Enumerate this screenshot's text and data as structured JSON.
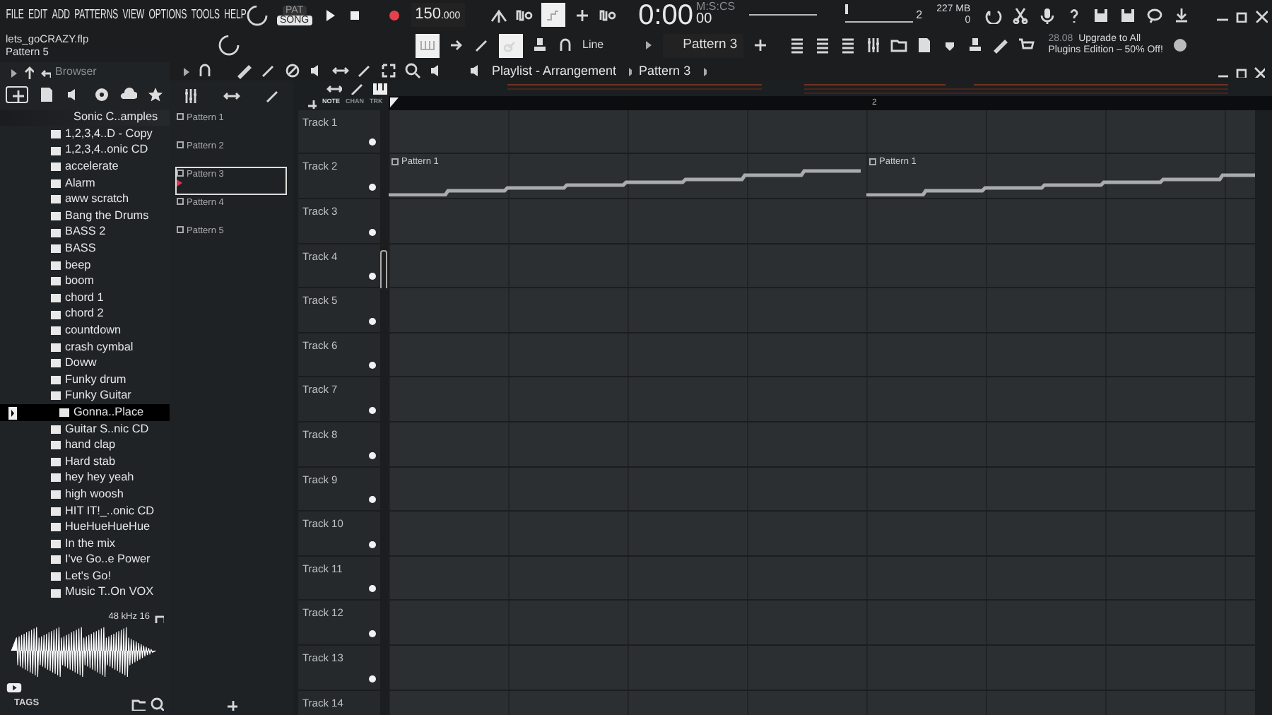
{
  "menu": [
    "FILE",
    "EDIT",
    "ADD",
    "PATTERNS",
    "VIEW",
    "OPTIONS",
    "TOOLS",
    "HELP"
  ],
  "project": {
    "file": "lets_goCRAZY.flp",
    "pattern": "Pattern 5"
  },
  "transport": {
    "pat_label": "PAT",
    "song_label": "SONG",
    "song_mode": true,
    "tempo": "150",
    "tempo_fraction": ".000",
    "time": "0:00",
    "time_small": "00",
    "time_label": "M:S:CS"
  },
  "monitor": {
    "volume_slider": {
      "level": 1
    },
    "pitch_slider": {
      "level": 0
    },
    "pitch": "2",
    "memory": "227 MB",
    "polyphony": "0"
  },
  "toolbar": {
    "snap": "Line",
    "pattern": "Pattern 3",
    "news_date": "28.08",
    "news_line1": "Upgrade to All",
    "news_line2": "Plugins Edition – 50% Off!"
  },
  "browser": {
    "title": "Browser",
    "folder": "Sonic C..amples",
    "items": [
      {
        "label": "1,2,3,4..D - Copy",
        "selected": false
      },
      {
        "label": "1,2,3,4..onic CD",
        "selected": false
      },
      {
        "label": "accelerate",
        "selected": false
      },
      {
        "label": "Alarm",
        "selected": false
      },
      {
        "label": "aww scratch",
        "selected": false
      },
      {
        "label": "Bang the Drums",
        "selected": false
      },
      {
        "label": "BASS 2",
        "selected": false
      },
      {
        "label": "BASS",
        "selected": false
      },
      {
        "label": "beep",
        "selected": false
      },
      {
        "label": "boom",
        "selected": false
      },
      {
        "label": "chord 1",
        "selected": false
      },
      {
        "label": "chord 2",
        "selected": false
      },
      {
        "label": "countdown",
        "selected": false
      },
      {
        "label": "crash cymbal",
        "selected": false
      },
      {
        "label": "Doww",
        "selected": false
      },
      {
        "label": "Funky drum",
        "selected": false
      },
      {
        "label": "Funky Guitar",
        "selected": false
      },
      {
        "label": "Gonna..Place",
        "selected": true
      },
      {
        "label": "Guitar S..nic CD",
        "selected": false
      },
      {
        "label": "hand clap",
        "selected": false
      },
      {
        "label": "Hard stab",
        "selected": false
      },
      {
        "label": "hey hey yeah",
        "selected": false
      },
      {
        "label": "high woosh",
        "selected": false
      },
      {
        "label": "HIT IT!_..onic CD",
        "selected": false
      },
      {
        "label": "HueHueHueHue",
        "selected": false
      },
      {
        "label": "In the mix",
        "selected": false
      },
      {
        "label": "I've Go..e Power",
        "selected": false
      },
      {
        "label": "Let's Go!",
        "selected": false
      },
      {
        "label": "Music T..On VOX",
        "selected": false
      }
    ],
    "sample_info": "48 kHz 16",
    "tags_label": "TAGS"
  },
  "picker": {
    "patterns": [
      {
        "label": "Pattern 1",
        "selected": false
      },
      {
        "label": "Pattern 2",
        "selected": false
      },
      {
        "label": "Pattern 3",
        "selected": true
      },
      {
        "label": "Pattern 4",
        "selected": false
      },
      {
        "label": "Pattern 5",
        "selected": false
      }
    ]
  },
  "playlist": {
    "title": "Playlist - Arrangement",
    "crumb": "Pattern 3",
    "modes": [
      "NOTE",
      "CHAN",
      "TRK"
    ],
    "bars": [
      "2"
    ],
    "tracks": [
      {
        "label": "Track 1"
      },
      {
        "label": "Track 2",
        "clips": [
          {
            "label": "Pattern 1"
          },
          {
            "label": "Pattern 1"
          }
        ]
      },
      {
        "label": "Track 3"
      },
      {
        "label": "Track 4"
      },
      {
        "label": "Track 5"
      },
      {
        "label": "Track 6"
      },
      {
        "label": "Track 7"
      },
      {
        "label": "Track 8"
      },
      {
        "label": "Track 9"
      },
      {
        "label": "Track 10"
      },
      {
        "label": "Track 11"
      },
      {
        "label": "Track 12"
      },
      {
        "label": "Track 13"
      },
      {
        "label": "Track 14"
      }
    ]
  }
}
